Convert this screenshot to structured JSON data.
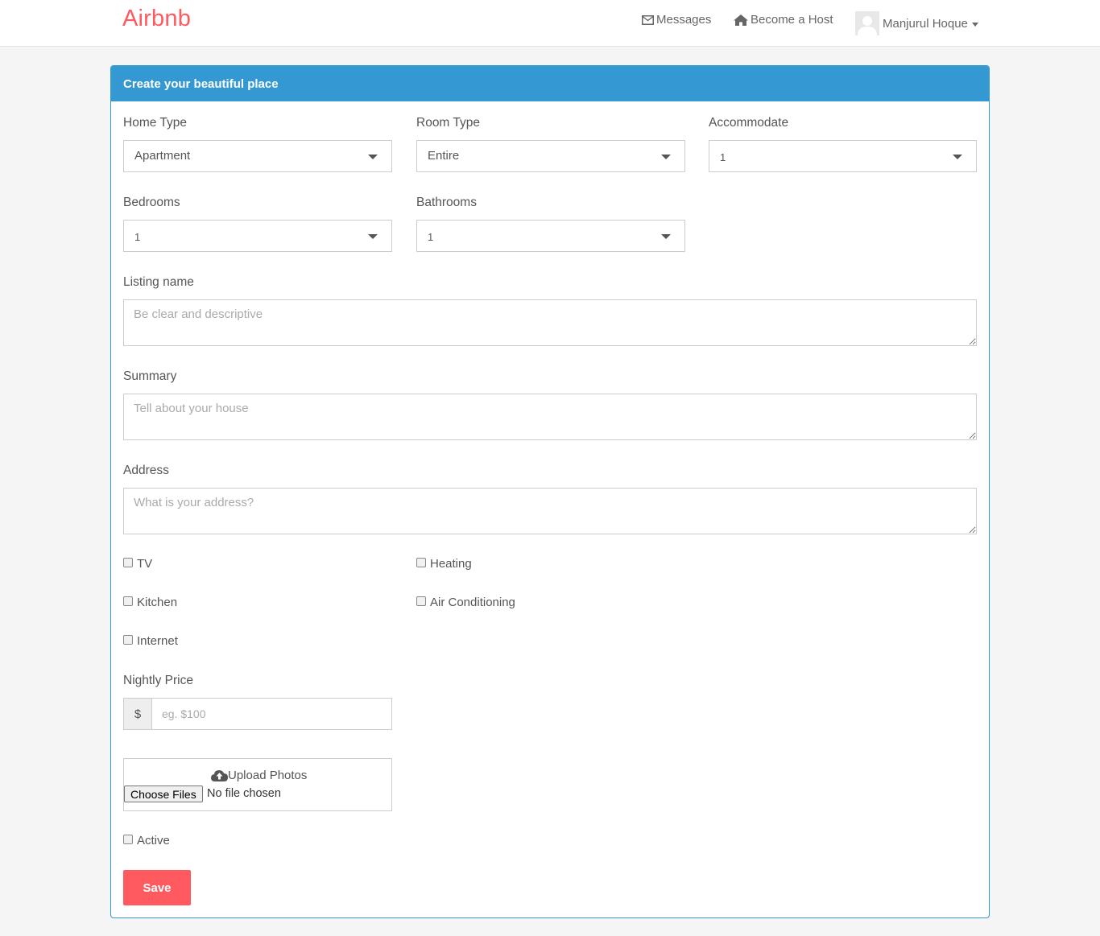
{
  "navbar": {
    "brand": "Airbnb",
    "messages": "Messages",
    "become_host": "Become a Host",
    "user_name": "Manjurul Hoque"
  },
  "panel": {
    "heading": "Create your beautiful place"
  },
  "form": {
    "home_type": {
      "label": "Home Type",
      "value": "Apartment"
    },
    "room_type": {
      "label": "Room Type",
      "value": "Entire"
    },
    "accommodate": {
      "label": "Accommodate",
      "value": "1"
    },
    "bedrooms": {
      "label": "Bedrooms",
      "value": "1"
    },
    "bathrooms": {
      "label": "Bathrooms",
      "value": "1"
    },
    "listing_name": {
      "label": "Listing name",
      "placeholder": "Be clear and descriptive"
    },
    "summary": {
      "label": "Summary",
      "placeholder": "Tell about your house"
    },
    "address": {
      "label": "Address",
      "placeholder": "What is your address?"
    },
    "amenities": {
      "tv": "TV",
      "heating": "Heating",
      "kitchen": "Kitchen",
      "air_conditioning": "Air Conditioning",
      "internet": "Internet"
    },
    "nightly_price": {
      "label": "Nightly Price",
      "currency": "$",
      "placeholder": "eg. $100"
    },
    "upload": {
      "title": "Upload Photos",
      "button": "Choose Files",
      "status": "No file chosen"
    },
    "active": "Active",
    "save": "Save"
  },
  "colors": {
    "brand": "#ff5a5f",
    "panel_header": "#3498d2",
    "save_button": "#ff5a5f"
  }
}
